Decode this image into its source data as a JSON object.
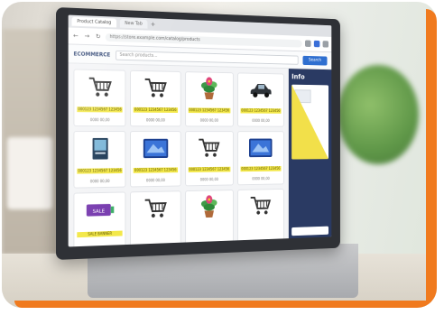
{
  "browser": {
    "tabs": [
      {
        "label": "Product Catalog",
        "active": true
      },
      {
        "label": "New Tab",
        "active": false
      }
    ],
    "add_tab_label": "+",
    "address": "https://store.example.com/catalog/products",
    "back_icon": "back-arrow-icon",
    "forward_icon": "forward-arrow-icon",
    "reload_icon": "reload-icon"
  },
  "app": {
    "brand": "ECOMMERCE",
    "search_placeholder": "Search products...",
    "search_button": "Search"
  },
  "products": [
    {
      "icon": "shopping-cart-icon",
      "label": "000123 1234567 123456",
      "meta": "0000  00,00"
    },
    {
      "icon": "shopping-cart-icon",
      "label": "000123 1234567 123456",
      "meta": "0000  00,00"
    },
    {
      "icon": "potted-plant-icon",
      "label": "000123 1234567 123456",
      "meta": "0000  00,00"
    },
    {
      "icon": "car-icon",
      "label": "000123 1234567 123456",
      "meta": "0000  00,00"
    },
    {
      "icon": "book-icon",
      "label": "000123 1234567 123456",
      "meta": "0000  00,00"
    },
    {
      "icon": "tablet-icon",
      "label": "000123 1234567 123456",
      "meta": "0000  00,00"
    },
    {
      "icon": "shopping-cart-icon",
      "label": "000123 1234567 123456",
      "meta": "0000  00,00"
    },
    {
      "icon": "tablet-icon",
      "label": "000123 1234567 123456",
      "meta": "0000  00,00"
    },
    {
      "icon": "label-sticker-icon",
      "label": "SALE BANNER",
      "meta": ""
    },
    {
      "icon": "shopping-cart-icon",
      "label": "",
      "meta": ""
    },
    {
      "icon": "potted-plant-icon",
      "label": "",
      "meta": ""
    },
    {
      "icon": "shopping-cart-icon",
      "label": "",
      "meta": ""
    }
  ],
  "side_panel": {
    "title": "Info"
  },
  "colors": {
    "accent": "#f07a1e",
    "price_tag": "#f3e84a",
    "panel": "#2a3a63",
    "button": "#2f6fd0"
  }
}
